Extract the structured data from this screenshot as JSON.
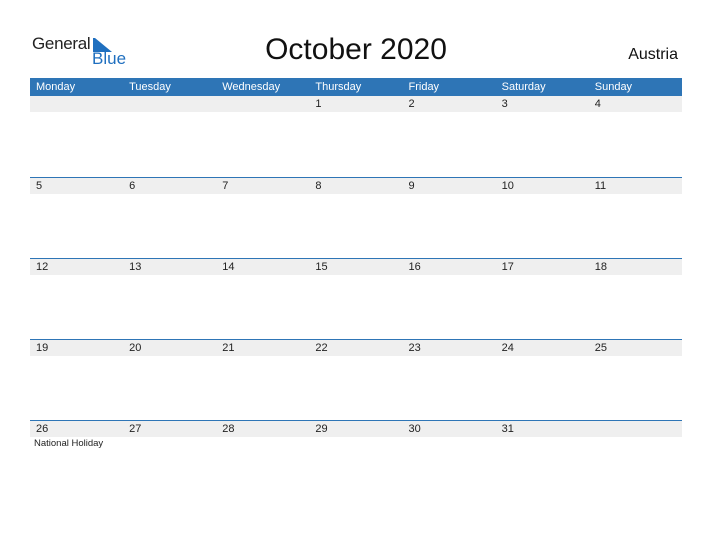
{
  "logo": {
    "line1": "General",
    "line2": "Blue"
  },
  "title": "October 2020",
  "country": "Austria",
  "colors": {
    "header": "#2e75b6",
    "date_strip": "#efefef",
    "logo_blue": "#1f6fbf"
  },
  "weekdays": [
    "Monday",
    "Tuesday",
    "Wednesday",
    "Thursday",
    "Friday",
    "Saturday",
    "Sunday"
  ],
  "weeks": [
    {
      "days": [
        "",
        "",
        "",
        "1",
        "2",
        "3",
        "4"
      ],
      "notes": [
        "",
        "",
        "",
        "",
        "",
        "",
        ""
      ]
    },
    {
      "days": [
        "5",
        "6",
        "7",
        "8",
        "9",
        "10",
        "11"
      ],
      "notes": [
        "",
        "",
        "",
        "",
        "",
        "",
        ""
      ]
    },
    {
      "days": [
        "12",
        "13",
        "14",
        "15",
        "16",
        "17",
        "18"
      ],
      "notes": [
        "",
        "",
        "",
        "",
        "",
        "",
        ""
      ]
    },
    {
      "days": [
        "19",
        "20",
        "21",
        "22",
        "23",
        "24",
        "25"
      ],
      "notes": [
        "",
        "",
        "",
        "",
        "",
        "",
        ""
      ]
    },
    {
      "days": [
        "26",
        "27",
        "28",
        "29",
        "30",
        "31",
        ""
      ],
      "notes": [
        "National Holiday",
        "",
        "",
        "",
        "",
        "",
        ""
      ]
    }
  ]
}
